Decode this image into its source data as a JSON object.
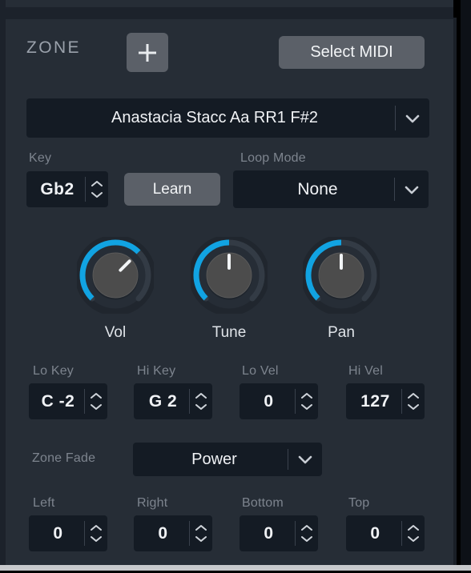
{
  "panel": {
    "title": "ZONE",
    "colors": {
      "background": "#262d36",
      "field": "#141b24",
      "button": "#5b6068",
      "accent": "#11a3e2",
      "label": "#7d848e",
      "value": "#f0f2f5"
    }
  },
  "header": {
    "title": "ZONE",
    "add_button": {
      "icon": "plus-icon",
      "label": "+"
    },
    "select_midi_button": {
      "label": "Select MIDI"
    }
  },
  "preset": {
    "label": "",
    "value": "Anastacia Stacc Aa RR1 F#2",
    "arrow_icon": "chevron-down-icon"
  },
  "key_row": {
    "key": {
      "label": "Key",
      "value": "Gb2"
    },
    "learn_button": {
      "label": "Learn"
    },
    "loop_mode": {
      "label": "Loop Mode",
      "value": "None",
      "arrow_icon": "chevron-down-icon"
    }
  },
  "knobs": [
    {
      "name": "vol",
      "label": "Vol",
      "angle_deg": 45,
      "arc_start_deg": -135,
      "arc_end_deg": 45
    },
    {
      "name": "tune",
      "label": "Tune",
      "angle_deg": 0,
      "arc_start_deg": -135,
      "arc_end_deg": 0
    },
    {
      "name": "pan",
      "label": "Pan",
      "angle_deg": 0,
      "arc_start_deg": -135,
      "arc_end_deg": 0
    }
  ],
  "range_row": [
    {
      "name": "lo-key",
      "label": "Lo Key",
      "value": "C -2"
    },
    {
      "name": "hi-key",
      "label": "Hi Key",
      "value": "G 2"
    },
    {
      "name": "lo-vel",
      "label": "Lo Vel",
      "value": "0"
    },
    {
      "name": "hi-vel",
      "label": "Hi Vel",
      "value": "127"
    }
  ],
  "zone_fade": {
    "label": "Zone Fade",
    "value": "Power",
    "arrow_icon": "chevron-down-icon"
  },
  "fade_row": [
    {
      "name": "left",
      "label": "Left",
      "value": "0"
    },
    {
      "name": "right",
      "label": "Right",
      "value": "0"
    },
    {
      "name": "bottom",
      "label": "Bottom",
      "value": "0"
    },
    {
      "name": "top",
      "label": "Top",
      "value": "0"
    }
  ]
}
